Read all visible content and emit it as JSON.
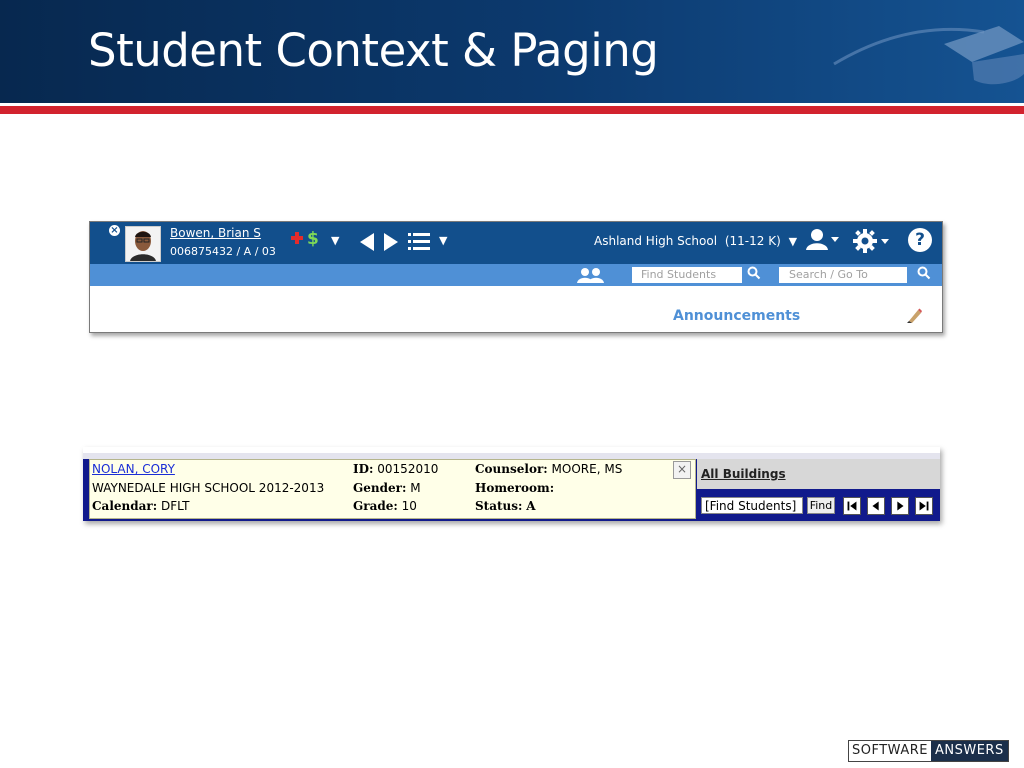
{
  "slide": {
    "title": "Student Context & Paging",
    "footer_logo_part1": "SOFTWARE",
    "footer_logo_part2": "ANSWERS"
  },
  "student_bar_1": {
    "student_name": "Bowen, Brian S",
    "student_id_line": "006875432 / A / 03",
    "school": "Ashland High School",
    "school_grades": "(11-12 K)",
    "find_students_placeholder": "Find Students",
    "search_placeholder": "Search / Go To",
    "announcements_label": "Announcements",
    "colors": {
      "top_bar": "#124f8c",
      "sub_bar": "#4f90d6",
      "health_icon": "#e32b2b",
      "fees_icon": "#7ed957"
    },
    "icons": [
      "close-icon",
      "avatar",
      "health-plus-icon",
      "fees-dollar-icon",
      "caret-down-icon",
      "prev-arrow-icon",
      "next-arrow-icon",
      "list-icon",
      "user-icon",
      "gear-icon",
      "help-icon",
      "group-icon",
      "search-icon",
      "pencil-icon"
    ]
  },
  "student_bar_2": {
    "student_name": "NOLAN, CORY",
    "school_year": "WAYNEDALE HIGH SCHOOL 2012-2013",
    "calendar_label": "Calendar:",
    "calendar_value": "DFLT",
    "id_label": "ID:",
    "id_value": "00152010",
    "gender_label": "Gender:",
    "gender_value": "M",
    "grade_label": "Grade:",
    "grade_value": "10",
    "counselor_label": "Counselor:",
    "counselor_value": "MOORE, MS",
    "homeroom_label": "Homeroom:",
    "homeroom_value": "",
    "status_label": "Status:",
    "status_value": "A",
    "all_buildings_link": "All Buildings",
    "find_students_value": "[Find Students]",
    "find_button": "Find",
    "colors": {
      "info_bg": "#ffffe8",
      "frame": "#111a8c",
      "link": "#1a2dd6"
    },
    "icons": [
      "close-icon",
      "first-page-icon",
      "prev-page-icon",
      "next-page-icon",
      "last-page-icon"
    ]
  }
}
